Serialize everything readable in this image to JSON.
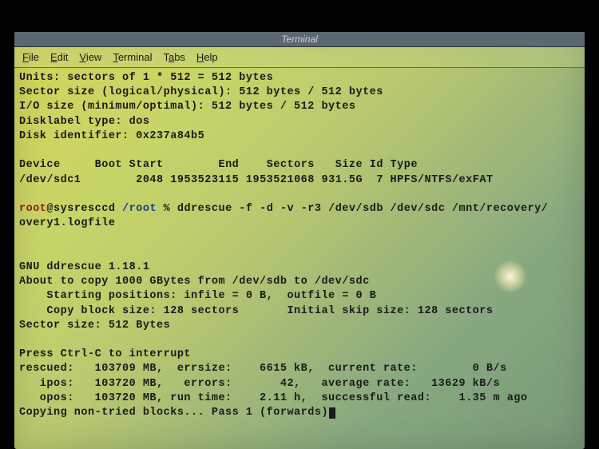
{
  "window": {
    "title": "Terminal"
  },
  "menubar": {
    "items": [
      "File",
      "Edit",
      "View",
      "Terminal",
      "Tabs",
      "Help"
    ]
  },
  "fdisk": {
    "units": "Units: sectors of 1 * 512 = 512 bytes",
    "sector_size": "Sector size (logical/physical): 512 bytes / 512 bytes",
    "io_size": "I/O size (minimum/optimal): 512 bytes / 512 bytes",
    "disklabel": "Disklabel type: dos",
    "disk_id": "Disk identifier: 0x237a84b5",
    "header": {
      "device": "Device",
      "boot": "Boot",
      "start": "Start",
      "end": "End",
      "sectors": "Sectors",
      "size": "Size",
      "id": "Id",
      "type": "Type"
    },
    "row": {
      "device": "/dev/sdc1",
      "boot": "",
      "start": "2048",
      "end": "1953523115",
      "sectors": "1953521068",
      "size": "931.5G",
      "id": "7",
      "type": "HPFS/NTFS/exFAT"
    }
  },
  "prompt": {
    "user": "root",
    "at": "@",
    "host": "sysresccd",
    "path": "/root",
    "sep": " % ",
    "command": "ddrescue -f -d -v -r3 /dev/sdb /dev/sdc /mnt/recovery/",
    "command2": "overy1.logfile"
  },
  "ddrescue": {
    "version": "GNU ddrescue 1.18.1",
    "about": "About to copy 1000 GBytes from /dev/sdb to /dev/sdc",
    "startpos": "    Starting positions: infile = 0 B,  outfile = 0 B",
    "copyblock": "    Copy block size: 128 sectors       Initial skip size: 128 sectors",
    "sectorsize": "Sector size: 512 Bytes",
    "interrupt": "Press Ctrl-C to interrupt",
    "stats": {
      "line1": "rescued:   103709 MB,  errsize:    6615 kB,  current rate:        0 B/s",
      "line2": "   ipos:   103720 MB,   errors:       42,   average rate:   13629 kB/s",
      "line3": "   opos:   103720 MB, run time:    2.11 h,  successful read:    1.35 m ago"
    },
    "status": "Copying non-tried blocks... Pass 1 (forwards)"
  }
}
